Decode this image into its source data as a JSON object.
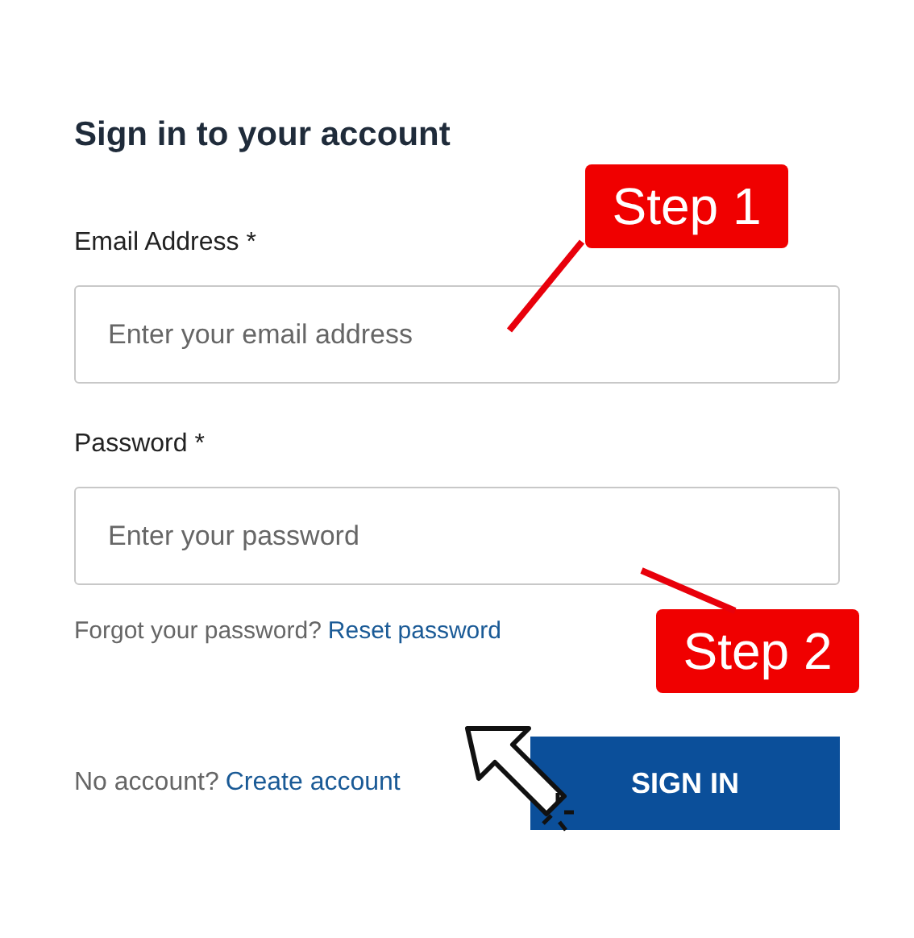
{
  "title": "Sign in to your account",
  "fields": [
    {
      "label": "Email Address *",
      "placeholder": "Enter your email address"
    },
    {
      "label": "Password *",
      "placeholder": "Enter your password"
    }
  ],
  "forgot": {
    "text": "Forgot your password?",
    "link": "Reset password"
  },
  "signup": {
    "text": "No account?",
    "link": "Create account"
  },
  "button": "SIGN IN",
  "annotations": [
    {
      "text": "Step 1"
    },
    {
      "text": "Step 2"
    }
  ]
}
